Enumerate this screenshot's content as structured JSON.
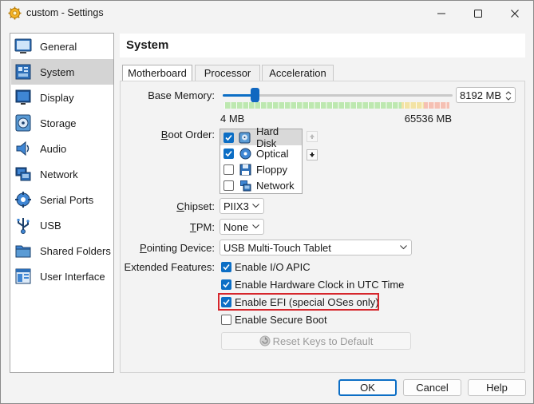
{
  "window": {
    "title": "custom - Settings"
  },
  "sidebar": {
    "items": [
      {
        "label": "General",
        "icon": "general-icon"
      },
      {
        "label": "System",
        "icon": "system-icon",
        "selected": true
      },
      {
        "label": "Display",
        "icon": "display-icon"
      },
      {
        "label": "Storage",
        "icon": "storage-icon"
      },
      {
        "label": "Audio",
        "icon": "audio-icon"
      },
      {
        "label": "Network",
        "icon": "network-icon"
      },
      {
        "label": "Serial Ports",
        "icon": "serial-ports-icon"
      },
      {
        "label": "USB",
        "icon": "usb-icon"
      },
      {
        "label": "Shared Folders",
        "icon": "shared-folders-icon"
      },
      {
        "label": "User Interface",
        "icon": "user-interface-icon"
      }
    ]
  },
  "page": {
    "title": "System",
    "tabs": [
      {
        "label": "Motherboard",
        "active": true
      },
      {
        "label": "Processor"
      },
      {
        "label": "Acceleration"
      }
    ]
  },
  "motherboard": {
    "base_memory": {
      "label": "Base Memory:",
      "value": "8192 MB",
      "min_label": "4 MB",
      "max_label": "65536 MB",
      "min_mb": 4,
      "max_mb": 65536,
      "current_mb": 8192
    },
    "boot_order": {
      "label": "Boot Order:",
      "items": [
        {
          "label": "Hard Disk",
          "checked": true,
          "icon": "hard-disk-icon"
        },
        {
          "label": "Optical",
          "checked": true,
          "icon": "optical-disc-icon"
        },
        {
          "label": "Floppy",
          "checked": false,
          "icon": "floppy-icon"
        },
        {
          "label": "Network",
          "checked": false,
          "icon": "network-boot-icon"
        }
      ]
    },
    "chipset": {
      "label": "Chipset:",
      "value": "PIIX3"
    },
    "tpm": {
      "label": "TPM:",
      "value": "None"
    },
    "pointing_device": {
      "label": "Pointing Device:",
      "value": "USB Multi-Touch Tablet"
    },
    "extended_features": {
      "label": "Extended Features:",
      "items": [
        {
          "label": "Enable I/O APIC",
          "checked": true
        },
        {
          "label": "Enable Hardware Clock in UTC Time",
          "checked": true
        },
        {
          "label": "Enable EFI (special OSes only)",
          "checked": true
        },
        {
          "label": "Enable Secure Boot",
          "checked": false
        }
      ]
    },
    "reset_keys_label": "Reset Keys to Default"
  },
  "buttons": {
    "ok": "OK",
    "cancel": "Cancel",
    "help": "Help"
  },
  "colors": {
    "accent": "#0c6ec5",
    "highlight": "#d6262c",
    "selected_bg": "#d4d4d4"
  }
}
